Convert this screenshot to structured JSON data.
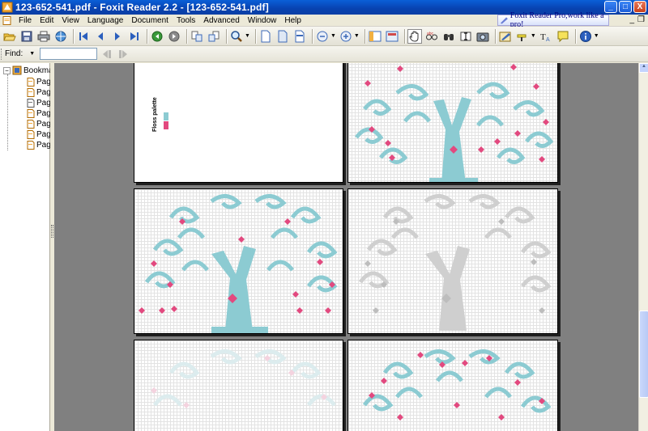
{
  "window": {
    "title": "123-652-541.pdf - Foxit Reader 2.2 - [123-652-541.pdf]",
    "minimize": "_",
    "maximize": "□",
    "close": "X"
  },
  "menu": {
    "items": [
      "File",
      "Edit",
      "View",
      "Language",
      "Document",
      "Tools",
      "Advanced",
      "Window",
      "Help"
    ],
    "promo": "Foxit Reader Pro,work like a pro!",
    "mdi_min": "_",
    "mdi_restore": "❐"
  },
  "find": {
    "label": "Find:",
    "value": ""
  },
  "bookmarks": {
    "root_label": "Bookma",
    "items": [
      "Page",
      "Page",
      "Page",
      "Page",
      "Page",
      "Page",
      "Page"
    ]
  },
  "pages": {
    "palette_label": "Floss palette"
  },
  "colors": {
    "tree": "#8ccbd2",
    "heart": "#e2497f",
    "faded_tree": "#cfcfcf",
    "faded_heart": "#bdbdbd",
    "light_tree": "#dcecee",
    "light_heart": "#f4d3df"
  }
}
